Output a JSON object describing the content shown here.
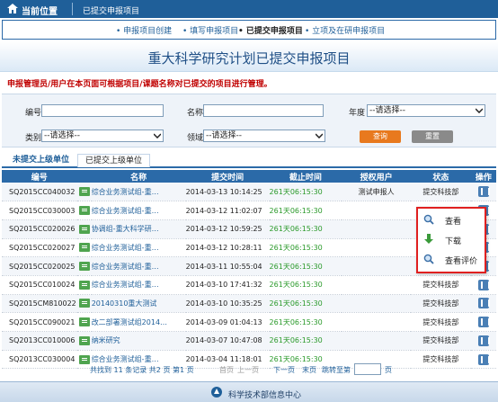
{
  "header": {
    "current_location": "当前位置",
    "breadcrumb": "已提交申报项目"
  },
  "steps": [
    "• 申报项目创建",
    "• 填写申报项目",
    "• 已提交申报项目",
    "• 立项及在研申报项目"
  ],
  "page_title": "重大科学研究计划已提交申报项目",
  "notice": "申报管理员/用户在本页面可根据项目/课题名称对已提交的项目进行管理。",
  "filter": {
    "code_label": "编号",
    "name_label": "名称",
    "year_label": "年度",
    "year_value": "--请选择--",
    "category_label": "类别",
    "category_value": "--请选择--",
    "field_label": "领域",
    "field_value": "--请选择--",
    "query_label": "查询",
    "reset_label": "重置"
  },
  "tabs": {
    "not_submitted": "未提交上级单位",
    "submitted": "已提交上级单位"
  },
  "table": {
    "headers": [
      "编号",
      "名称",
      "提交时间",
      "截止时间",
      "授权用户",
      "状态",
      "操作"
    ],
    "rows": [
      {
        "code": "SQ2015CC040032",
        "name": "综合业务测试组-重…",
        "time": "2014-03-13 10:14:25",
        "deadline": "261天06:15:30",
        "user": "测试申报人",
        "status": "提交科技部"
      },
      {
        "code": "SQ2015CC030003",
        "name": "综合业务测试组-重…",
        "time": "2014-03-12 11:02:07",
        "deadline": "261天06:15:30",
        "user": "",
        "status": ""
      },
      {
        "code": "SQ2015CC020026",
        "name": "协调组-重大科学研…",
        "time": "2014-03-12 10:59:25",
        "deadline": "261天06:15:30",
        "user": "",
        "status": ""
      },
      {
        "code": "SQ2015CC020027",
        "name": "综合业务测试组-重…",
        "time": "2014-03-12 10:28:11",
        "deadline": "261天06:15:30",
        "user": "",
        "status": ""
      },
      {
        "code": "SQ2015CC020025",
        "name": "综合业务测试组-重…",
        "time": "2014-03-11 10:55:04",
        "deadline": "261天06:15:30",
        "user": "",
        "status": "提交科技部"
      },
      {
        "code": "SQ2015CC010024",
        "name": "综合业务测试组-重…",
        "time": "2014-03-10 17:41:32",
        "deadline": "261天06:15:30",
        "user": "",
        "status": "提交科技部"
      },
      {
        "code": "SQ2015CM810022",
        "name": "20140310重大测试",
        "time": "2014-03-10 10:35:25",
        "deadline": "261天06:15:30",
        "user": "",
        "status": "提交科技部"
      },
      {
        "code": "SQ2015CC090021",
        "name": "改二部署测试组2014…",
        "time": "2014-03-09 01:04:13",
        "deadline": "261天06:15:30",
        "user": "",
        "status": "提交科技部"
      },
      {
        "code": "SQ2013CC010006",
        "name": "纳米研究",
        "time": "2014-03-07 10:47:08",
        "deadline": "261天06:15:30",
        "user": "",
        "status": "提交科技部"
      },
      {
        "code": "SQ2013CC030004",
        "name": "综合业务测试组-重…",
        "time": "2014-03-04 11:18:01",
        "deadline": "261天06:15:30",
        "user": "",
        "status": "提交科技部"
      }
    ]
  },
  "popup": {
    "view": "查看",
    "download": "下载",
    "view_review": "查看评价"
  },
  "pager": {
    "total": "共找到 11 条记录 共2 页 第1 页",
    "first": "首页",
    "prev": "上一页",
    "next": "下一页",
    "last": "末页",
    "jump": "跳转至第",
    "page_unit": "页"
  },
  "footer": "科学技术部信息中心"
}
